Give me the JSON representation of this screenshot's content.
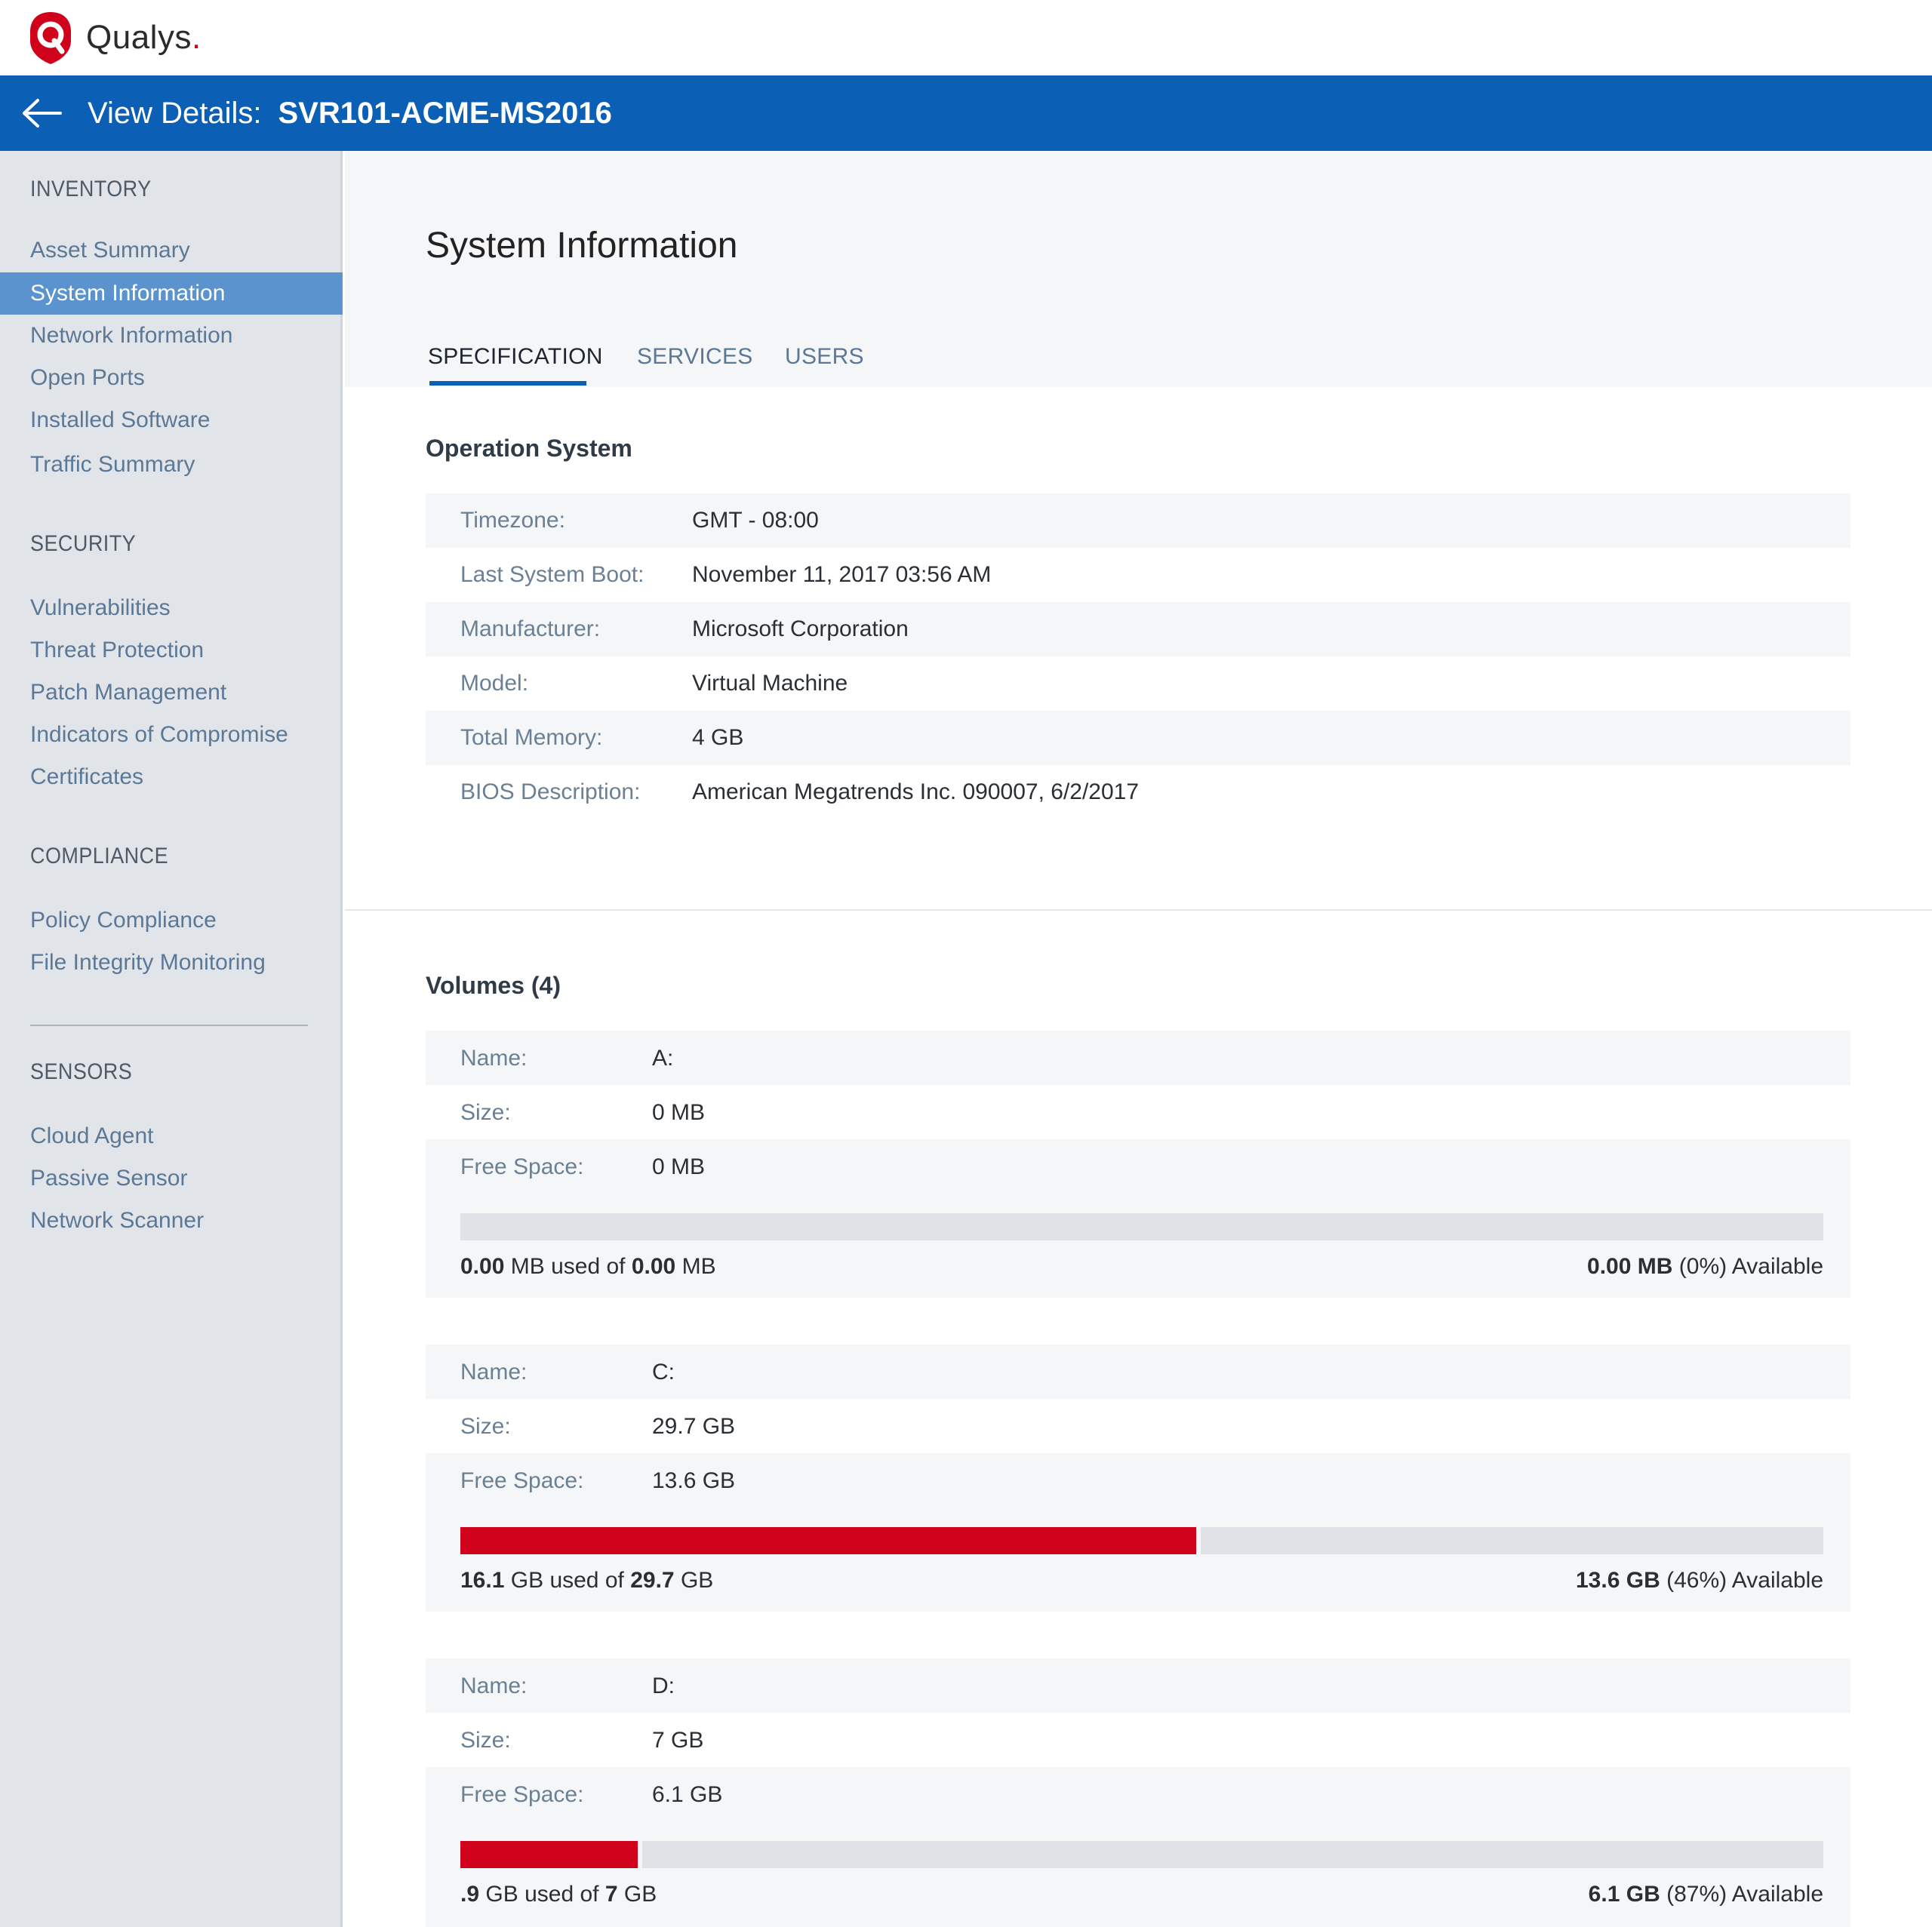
{
  "brand": {
    "name": "Qualys",
    "dot": ".",
    "accent": "#d0021b",
    "header_color": "#0b5fb4"
  },
  "header": {
    "label": "View Details:",
    "host": "SVR101-ACME-MS2016"
  },
  "sidebar": {
    "sections": [
      {
        "title": "INVENTORY",
        "items": [
          "Asset Summary",
          "System Information",
          "Network Information",
          "Open Ports",
          "Installed Software",
          "Traffic Summary"
        ]
      },
      {
        "title": "SECURITY",
        "items": [
          "Vulnerabilities",
          "Threat Protection",
          "Patch Management",
          "Indicators of Compromise",
          "Certificates"
        ]
      },
      {
        "title": "COMPLIANCE",
        "items": [
          "Policy Compliance",
          "File Integrity Monitoring"
        ]
      },
      {
        "title": "SENSORS",
        "items": [
          "Cloud Agent",
          "Passive Sensor",
          "Network Scanner"
        ]
      }
    ],
    "active_item": "System Information"
  },
  "main": {
    "title": "System Information",
    "tabs": [
      "SPECIFICATION",
      "SERVICES",
      "USERS"
    ],
    "active_tab": "SPECIFICATION",
    "os": {
      "heading": "Operation System",
      "rows": [
        {
          "label": "Timezone:",
          "value": "GMT - 08:00"
        },
        {
          "label": "Last System Boot:",
          "value": "November 11, 2017 03:56 AM"
        },
        {
          "label": "Manufacturer:",
          "value": "Microsoft Corporation"
        },
        {
          "label": "Model:",
          "value": "Virtual Machine"
        },
        {
          "label": "Total Memory:",
          "value": "4 GB"
        },
        {
          "label": "BIOS Description:",
          "value": "American Megatrends Inc. 090007, 6/2/2017"
        }
      ]
    },
    "volumes": {
      "heading": "Volumes (4)",
      "labels": {
        "name": "Name:",
        "size": "Size:",
        "free": "Free Space:"
      },
      "items": [
        {
          "name": "A:",
          "size": "0 MB",
          "free": "0 MB",
          "used_fraction": 0,
          "used_num": "0.00",
          "used_unit": "MB",
          "used_of": "used of",
          "total_num": "0.00",
          "total_unit": "MB",
          "avail_num": "0.00",
          "avail_unit": "MB",
          "avail_pct": "(0%)",
          "avail_word": "Available"
        },
        {
          "name": "C:",
          "size": "29.7 GB",
          "free": "13.6 GB",
          "used_fraction": 0.54,
          "used_num": "16.1",
          "used_unit": "GB",
          "used_of": "used of",
          "total_num": "29.7",
          "total_unit": "GB",
          "avail_num": "13.6",
          "avail_unit": "GB",
          "avail_pct": "(46%)",
          "avail_word": "Available"
        },
        {
          "name": "D:",
          "size": "7 GB",
          "free": "6.1 GB",
          "used_fraction": 0.13,
          "used_num": ".9",
          "used_unit": "GB",
          "used_of": "used of",
          "total_num": "7",
          "total_unit": "GB",
          "avail_num": "6.1",
          "avail_unit": "GB",
          "avail_pct": "(87%)",
          "avail_word": "Available"
        }
      ]
    }
  }
}
